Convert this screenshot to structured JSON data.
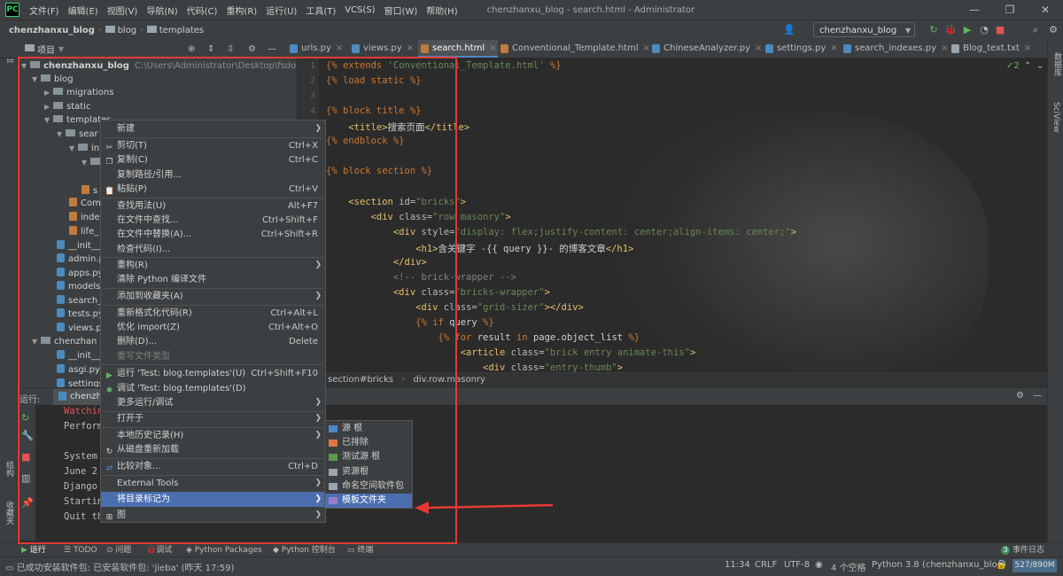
{
  "menubar": {
    "items": [
      "文件(F)",
      "编辑(E)",
      "视图(V)",
      "导航(N)",
      "代码(C)",
      "重构(R)",
      "运行(U)",
      "工具(T)",
      "VCS(S)",
      "窗口(W)",
      "帮助(H)"
    ],
    "window_title": "chenzhanxu_blog - search.html - Administrator"
  },
  "navbar": {
    "crumbs": [
      "chenzhanxu_blog",
      "blog",
      "templates"
    ],
    "run_config": "chenzhanxu_blog"
  },
  "project_header": "项目",
  "tabs": [
    {
      "label": "urls.py",
      "color": "#4b8bbf"
    },
    {
      "label": "views.py",
      "color": "#4b8bbf"
    },
    {
      "label": "search.html",
      "color": "#c27b3f"
    },
    {
      "label": "Conventional_Template.html",
      "color": "#c27b3f"
    },
    {
      "label": "ChineseAnalyzer.py",
      "color": "#4b8bbf"
    },
    {
      "label": "settings.py",
      "color": "#4b8bbf"
    },
    {
      "label": "search_indexes.py",
      "color": "#4b8bbf"
    },
    {
      "label": "Blog_text.txt",
      "color": "#9aa7b0"
    }
  ],
  "tree": {
    "root_name": "chenzhanxu_blog",
    "root_path": "C:\\Users\\Administrator\\Desktop\\fsdow",
    "items": [
      "blog",
      "migrations",
      "static",
      "templates",
      "sear",
      "in",
      "",
      "s",
      "Com",
      "inde",
      "life_",
      "__init__",
      "admin.p",
      "apps.py",
      "models",
      "search_",
      "tests.py",
      "views.p",
      "chenzhan",
      "__init__",
      "asgi.py",
      "settings"
    ]
  },
  "editor": {
    "line_numbers": [
      "1",
      "2",
      "3",
      "4"
    ],
    "inline_hint": "2",
    "breadcrumb": [
      "section#bricks",
      "div.row.masonry"
    ]
  },
  "run_panel": {
    "label": "运行:",
    "tab": "chenzha",
    "console": [
      "Watchin",
      "Perform",
      "",
      "System",
      "June 2",
      "Django",
      "Startin",
      "Quit th"
    ]
  },
  "context_menu": {
    "items": [
      {
        "label": "新建",
        "shortcut": "",
        "sub": true
      },
      {
        "label": "剪切(T)",
        "shortcut": "Ctrl+X"
      },
      {
        "label": "复制(C)",
        "shortcut": "Ctrl+C"
      },
      {
        "label": "复制路径/引用...",
        "shortcut": ""
      },
      {
        "label": "粘贴(P)",
        "shortcut": "Ctrl+V"
      },
      {
        "label": "查找用法(U)",
        "shortcut": "Alt+F7"
      },
      {
        "label": "在文件中查找...",
        "shortcut": "Ctrl+Shift+F"
      },
      {
        "label": "在文件中替换(A)...",
        "shortcut": "Ctrl+Shift+R"
      },
      {
        "label": "检查代码(I)...",
        "shortcut": ""
      },
      {
        "label": "重构(R)",
        "shortcut": "",
        "sub": true
      },
      {
        "label": "清除 Python 编译文件",
        "shortcut": ""
      },
      {
        "label": "添加到收藏夹(A)",
        "shortcut": "",
        "sub": true
      },
      {
        "label": "重新格式化代码(R)",
        "shortcut": "Ctrl+Alt+L"
      },
      {
        "label": "优化 import(Z)",
        "shortcut": "Ctrl+Alt+O"
      },
      {
        "label": "删除(D)...",
        "shortcut": "Delete"
      },
      {
        "label": "重写文件类型",
        "shortcut": ""
      },
      {
        "label": "运行 'Test: blog.templates'(U)",
        "shortcut": "Ctrl+Shift+F10"
      },
      {
        "label": "调试 'Test: blog.templates'(D)",
        "shortcut": ""
      },
      {
        "label": "更多运行/调试",
        "shortcut": "",
        "sub": true
      },
      {
        "label": "打开于",
        "shortcut": "",
        "sub": true
      },
      {
        "label": "本地历史记录(H)",
        "shortcut": "",
        "sub": true
      },
      {
        "label": "从磁盘重新加载",
        "shortcut": ""
      },
      {
        "label": "比较对象...",
        "shortcut": "Ctrl+D"
      },
      {
        "label": "External Tools",
        "shortcut": "",
        "sub": true
      },
      {
        "label": "将目录标记为",
        "shortcut": "",
        "sub": true
      },
      {
        "label": "图",
        "shortcut": "",
        "sub": true
      }
    ]
  },
  "submenu": {
    "items": [
      {
        "label": "源 根",
        "color": "#4a88c7"
      },
      {
        "label": "已排除",
        "color": "#e0763d"
      },
      {
        "label": "测试源 根",
        "color": "#5a9a4c"
      },
      {
        "label": "资源根",
        "color": "#9aa7b0"
      },
      {
        "label": "命名空间软件包",
        "color": "#9aa7b0"
      },
      {
        "label": "模板文件夹",
        "color": "#9a7ec9"
      }
    ]
  },
  "bottom_tabs": [
    "运行",
    "TODO",
    "问题",
    "调试",
    "Python Packages",
    "Python 控制台",
    "终端",
    "事件日志"
  ],
  "event_count": "3",
  "statusbar": {
    "message": "已成功安装软件包: 已安装软件包: 'jieba' (昨天 17:59)",
    "position": "11:34",
    "line_sep": "CRLF",
    "encoding": "UTF-8",
    "indent": "4 个空格",
    "interpreter": "Python 3.8 (chenzhanxu_blog)",
    "memory": "527/890M"
  },
  "side_labels": {
    "left_top": "项目",
    "left_bottom1": "结构",
    "left_bottom2": "收藏夹",
    "right_top": "数据库",
    "right_bottom": "SciView"
  },
  "colors": {
    "accent": "#4b6eaf",
    "annotation": "#e53935"
  }
}
